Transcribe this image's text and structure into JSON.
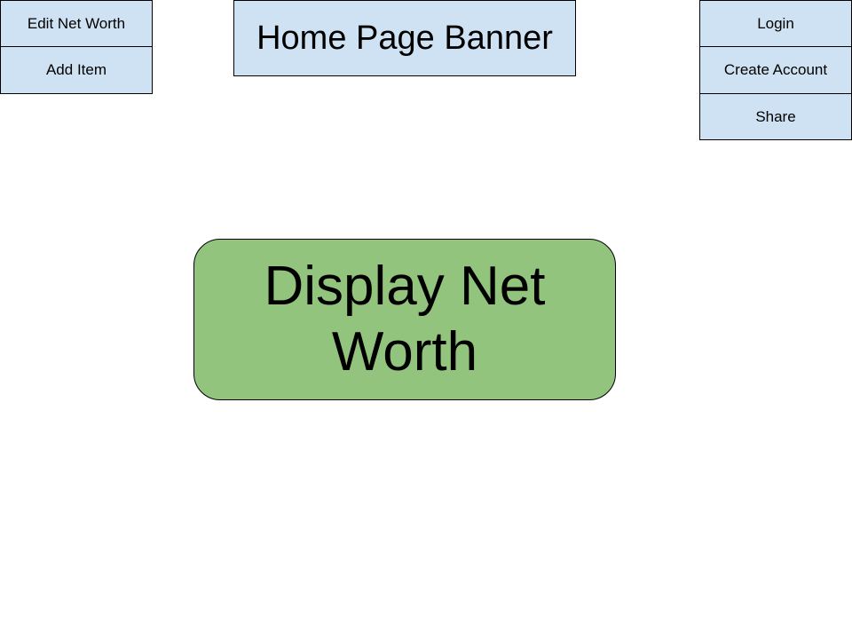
{
  "left_menu": {
    "edit_net_worth_label": "Edit Net Worth",
    "add_item_label": "Add Item"
  },
  "header": {
    "banner_text": "Home Page Banner"
  },
  "right_menu": {
    "login_label": "Login",
    "create_account_label": "Create Account",
    "share_label": "Share"
  },
  "main": {
    "display_text": "Display Net Worth"
  },
  "colors": {
    "button_fill": "#cfe2f3",
    "display_fill": "#93c47d",
    "border": "#000000",
    "background": "#ffffff"
  }
}
